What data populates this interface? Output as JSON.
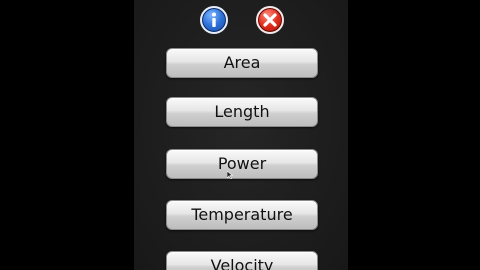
{
  "screen": {
    "icons": {
      "info": "info-icon",
      "close": "close-icon"
    },
    "menu": [
      {
        "label": "Area"
      },
      {
        "label": "Length"
      },
      {
        "label": "Power"
      },
      {
        "label": "Temperature"
      },
      {
        "label": "Velocity"
      }
    ]
  },
  "colors": {
    "background": "#000000",
    "panel": "#1e1e1e",
    "info_blue": "#2f74d9",
    "close_red": "#e02b1c",
    "button_face": "#e6e6e6"
  }
}
